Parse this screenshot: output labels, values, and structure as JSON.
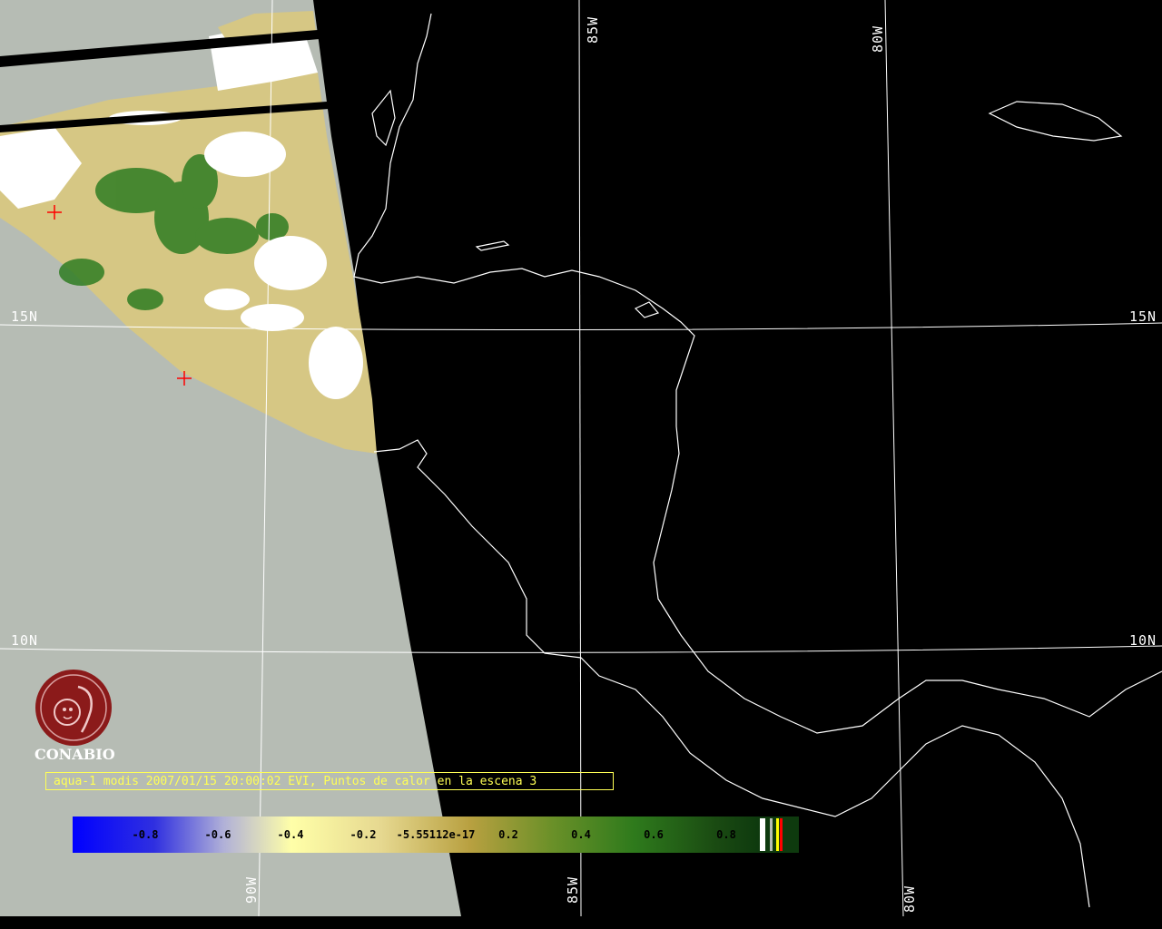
{
  "map": {
    "grid_labels": {
      "lat_15_left": "15N",
      "lat_15_right": "15N",
      "lat_10_left": "10N",
      "lat_10_right": "10N",
      "lon_85_top": "85W",
      "lon_80_top": "80W",
      "lon_90_bottom": "90W",
      "lon_85_bottom": "85W",
      "lon_80_bottom": "80W"
    },
    "hotspots": [
      {
        "name": "hotspot-1"
      },
      {
        "name": "hotspot-2"
      }
    ],
    "colors": {
      "background": "#000000",
      "nodata_swath": "#b6bcb4",
      "land_bare": "#d8c888",
      "vegetation": "#2e7a20",
      "cloud": "#ffffff",
      "coastline": "#ffffff",
      "grid": "#ffffff",
      "hotspot": "#ff0000",
      "caption": "#ffff55"
    }
  },
  "logo": {
    "org_name": "CONABIO",
    "color": "#8b1a1a"
  },
  "caption": {
    "text": "aqua-1 modis 2007/01/15 20:00:02 EVI, Puntos de calor en la escena 3"
  },
  "colorbar": {
    "labels": [
      "-0.8",
      "-0.6",
      "-0.4",
      "-0.2",
      "-5.55112e-17",
      "0.2",
      "0.4",
      "0.6",
      "0.8"
    ]
  }
}
